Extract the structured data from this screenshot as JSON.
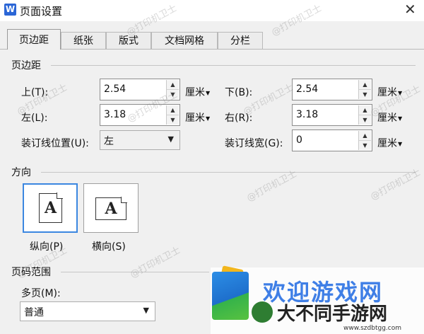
{
  "window": {
    "icon_letter": "W",
    "title": "页面设置",
    "close_glyph": "✕"
  },
  "tabs": [
    {
      "label": "页边距",
      "active": true
    },
    {
      "label": "纸张"
    },
    {
      "label": "版式"
    },
    {
      "label": "文档网格"
    },
    {
      "label": "分栏"
    }
  ],
  "margins": {
    "group_label": "页边距",
    "top": {
      "label": "上(T):",
      "value": "2.54",
      "unit": "厘米"
    },
    "bottom": {
      "label": "下(B):",
      "value": "2.54",
      "unit": "厘米"
    },
    "left": {
      "label": "左(L):",
      "value": "3.18",
      "unit": "厘米"
    },
    "right": {
      "label": "右(R):",
      "value": "3.18",
      "unit": "厘米"
    },
    "gutter_position": {
      "label": "装订线位置(U):",
      "value": "左"
    },
    "gutter_width": {
      "label": "装订线宽(G):",
      "value": "0",
      "unit": "厘米"
    }
  },
  "orientation": {
    "group_label": "方向",
    "portrait_label": "纵向(P)",
    "landscape_label": "横向(S)",
    "paper_glyph": "A",
    "selected": "portrait"
  },
  "pages": {
    "group_label": "页码范围",
    "multiple_pages_label": "多页(M):",
    "multiple_pages_value": "普通"
  },
  "watermark_text": "@打印机卫士",
  "banner": {
    "title": "欢迎游戏网",
    "subtitle": "大不同手游网",
    "url": "www.szdbtgg.com"
  },
  "icons": {
    "spin_up": "▲",
    "spin_down": "▼",
    "dropdown": "▼",
    "unit_caret": "▼"
  },
  "colors": {
    "accent": "#3b87e0",
    "banner_title": "#3f7fe6"
  }
}
